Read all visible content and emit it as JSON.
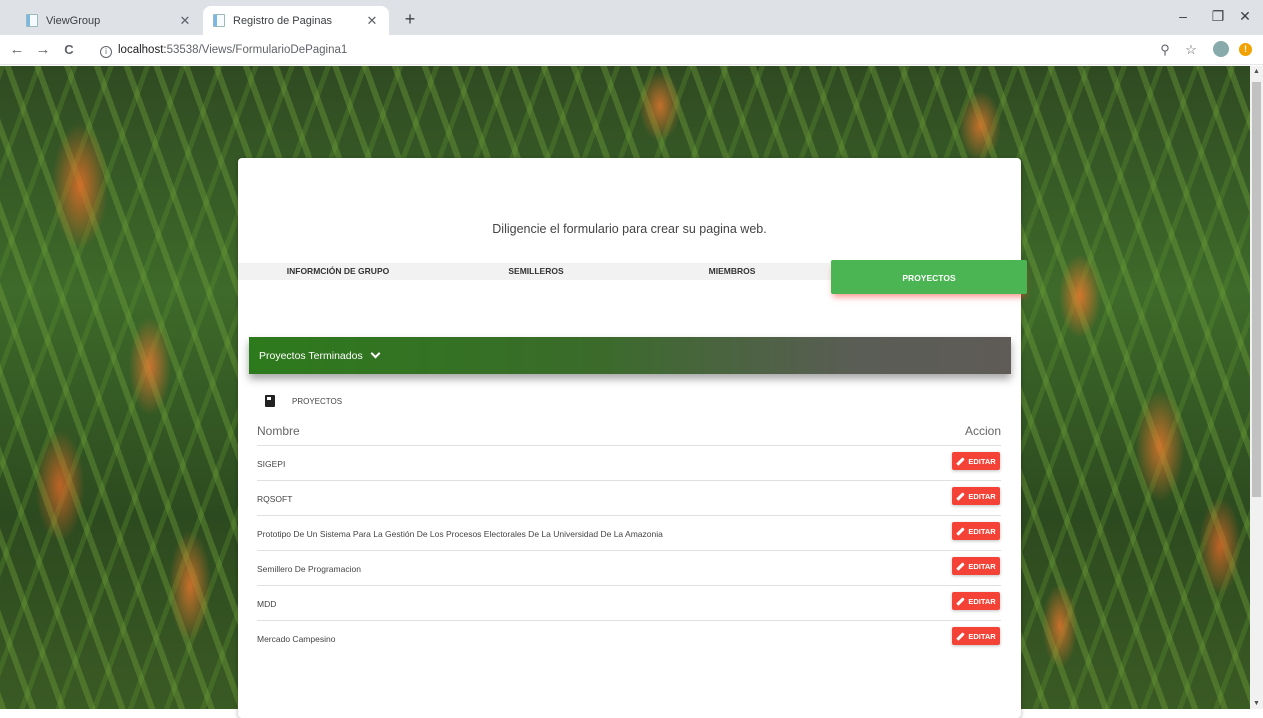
{
  "browser": {
    "tabs": [
      {
        "title": "ViewGroup",
        "active": false
      },
      {
        "title": "Registro de Paginas",
        "active": true
      }
    ],
    "new_tab": "+",
    "window": {
      "minimize": "–",
      "restore": "❐",
      "close": "✕"
    },
    "nav": {
      "back": "←",
      "forward": "→",
      "reload": "C"
    },
    "url_host": "localhost:",
    "url_path": "53538/Views/FormularioDePagina1",
    "info": "i",
    "right_icons": {
      "zoom": "⚲",
      "star": "☆"
    },
    "ext_badge": "!"
  },
  "page": {
    "instruction": "Diligencie el formulario para crear su pagina web.",
    "tabs": [
      {
        "label": "INFORMCIÓN DE GRUPO"
      },
      {
        "label": "SEMILLEROS"
      },
      {
        "label": "MIEMBROS"
      },
      {
        "label": "PROYECTOS",
        "active": true
      }
    ],
    "collapsible": {
      "label": "Proyectos Terminados"
    },
    "section_label": "PROYECTOS",
    "table": {
      "headers": [
        "Nombre",
        "Accion"
      ],
      "edit_label": "EDITAR",
      "rows": [
        {
          "name": "SIGEPI"
        },
        {
          "name": "RQSOFT"
        },
        {
          "name": "Prototipo De Un Sistema Para La Gestión De Los Procesos Electorales De La Universidad De La Amazonia"
        },
        {
          "name": "Semillero De Programacion"
        },
        {
          "name": "MDD"
        },
        {
          "name": "Mercado Campesino"
        }
      ]
    },
    "colors": {
      "accent_green": "#4cb553",
      "edit_red": "#f44336"
    }
  }
}
